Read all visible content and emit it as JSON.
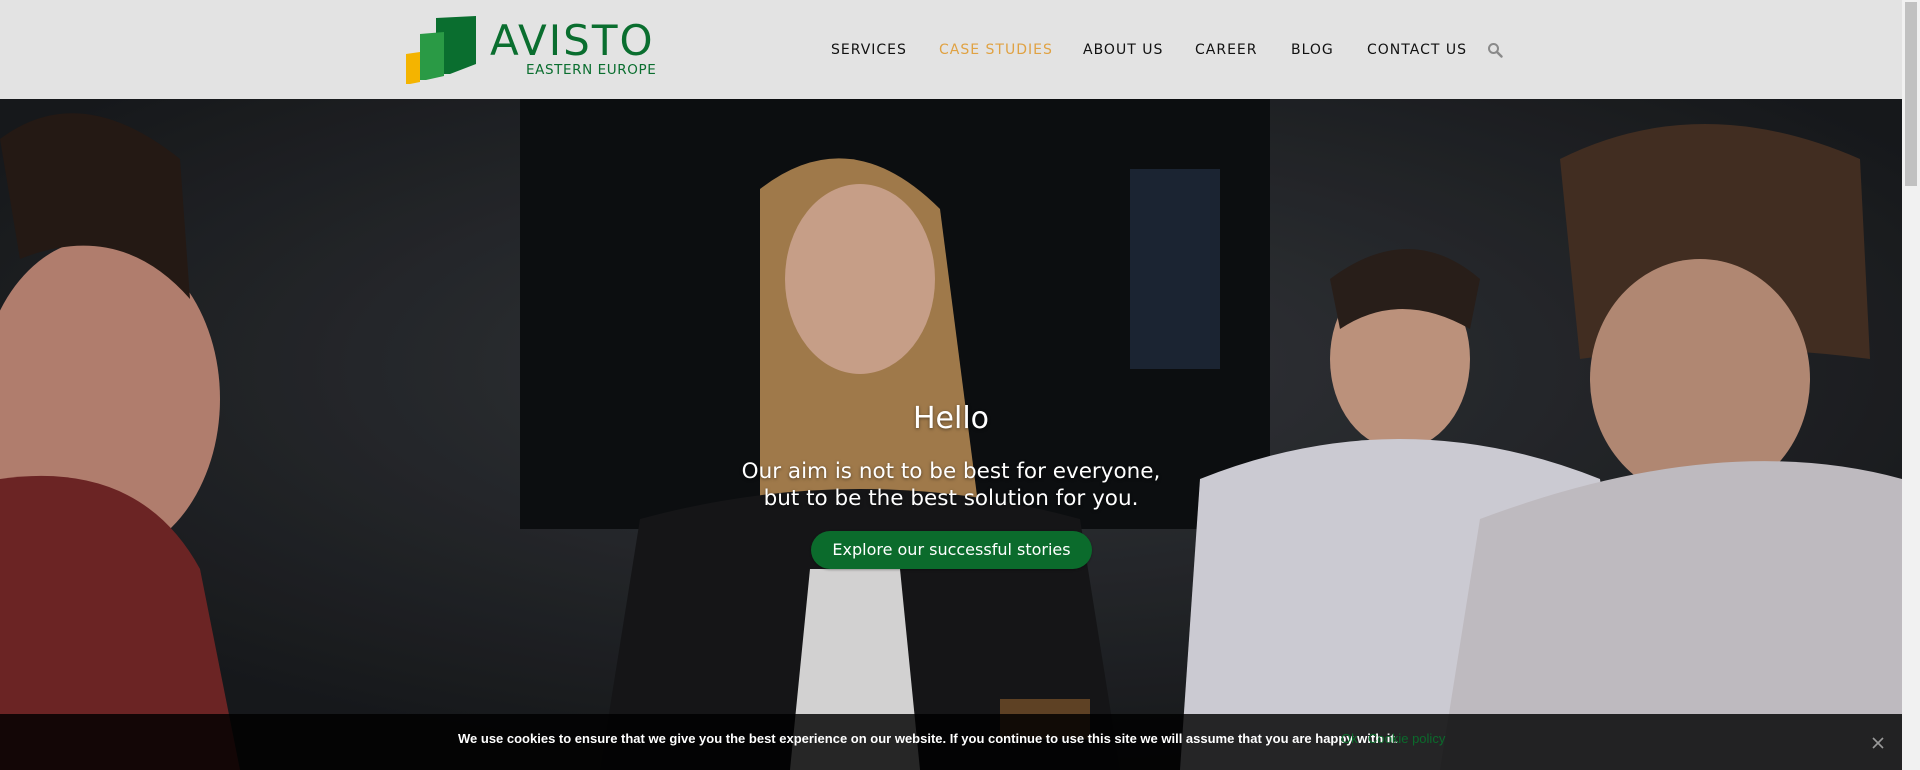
{
  "brand": {
    "name": "AVISTO",
    "subtitle": "EASTERN EUROPE",
    "colors": {
      "green": "#0b6b2c",
      "yellow": "#f4b400",
      "accent": "#e0a243"
    }
  },
  "nav": {
    "items": [
      {
        "label": "SERVICES",
        "active": false
      },
      {
        "label": "CASE STUDIES",
        "active": true
      },
      {
        "label": "ABOUT US",
        "active": false
      },
      {
        "label": "CAREER",
        "active": false
      },
      {
        "label": "BLOG",
        "active": false
      },
      {
        "label": "CONTACT US",
        "active": false
      }
    ],
    "search_icon": "search-icon"
  },
  "hero": {
    "title": "Hello",
    "subtitle_line1": "Our aim is not to be best for everyone,",
    "subtitle_line2": "but to be the best solution for you.",
    "cta_label": "Explore our successful stories"
  },
  "cookie": {
    "text": "We use cookies to ensure that we give you the best experience on our website. If you continue to use this site we will assume that you are happy with it.",
    "ok_label": "Ok",
    "policy_label": "Cookie policy",
    "close_icon": "close-icon"
  }
}
